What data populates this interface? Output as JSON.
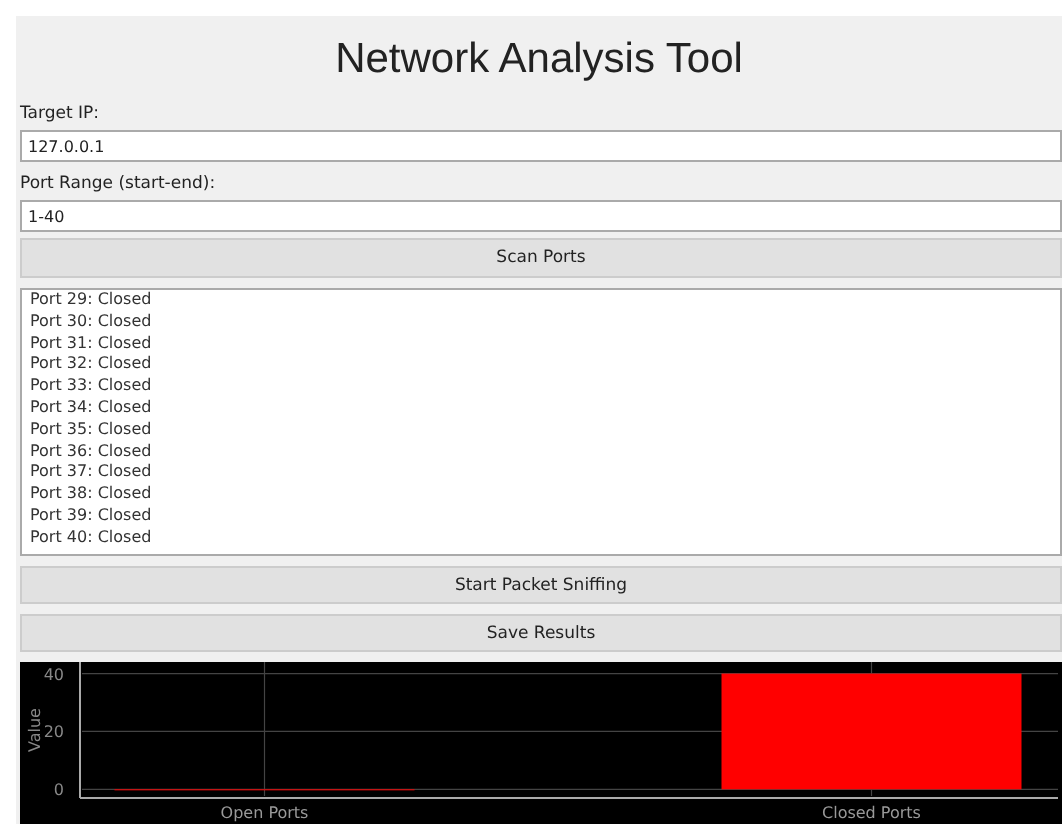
{
  "window": {
    "title": "Network Analysis Tool"
  },
  "target_ip": {
    "label": "Target IP:",
    "value": "127.0.0.1"
  },
  "port_range": {
    "label": "Port Range (start-end):",
    "value": "1-40"
  },
  "scan_button": "Scan Ports",
  "results": [
    "Port 29: Closed",
    "Port 30: Closed",
    "Port 31: Closed",
    "Port 32: Closed",
    "Port 33: Closed",
    "Port 34: Closed",
    "Port 35: Closed",
    "Port 36: Closed",
    "Port 37: Closed",
    "Port 38: Closed",
    "Port 39: Closed",
    "Port 40: Closed"
  ],
  "buttons": [
    "Start Packet Sniffing",
    "Save Results"
  ],
  "chart_data": {
    "type": "bar",
    "ylabel": "Value",
    "categories": [
      "Open Ports",
      "Closed Ports"
    ],
    "series": [
      {
        "color": "#ff0000",
        "values": [
          0,
          40
        ]
      }
    ],
    "ylim": [
      -3,
      44
    ],
    "yticks": [
      0,
      20,
      40
    ],
    "grid": true
  }
}
